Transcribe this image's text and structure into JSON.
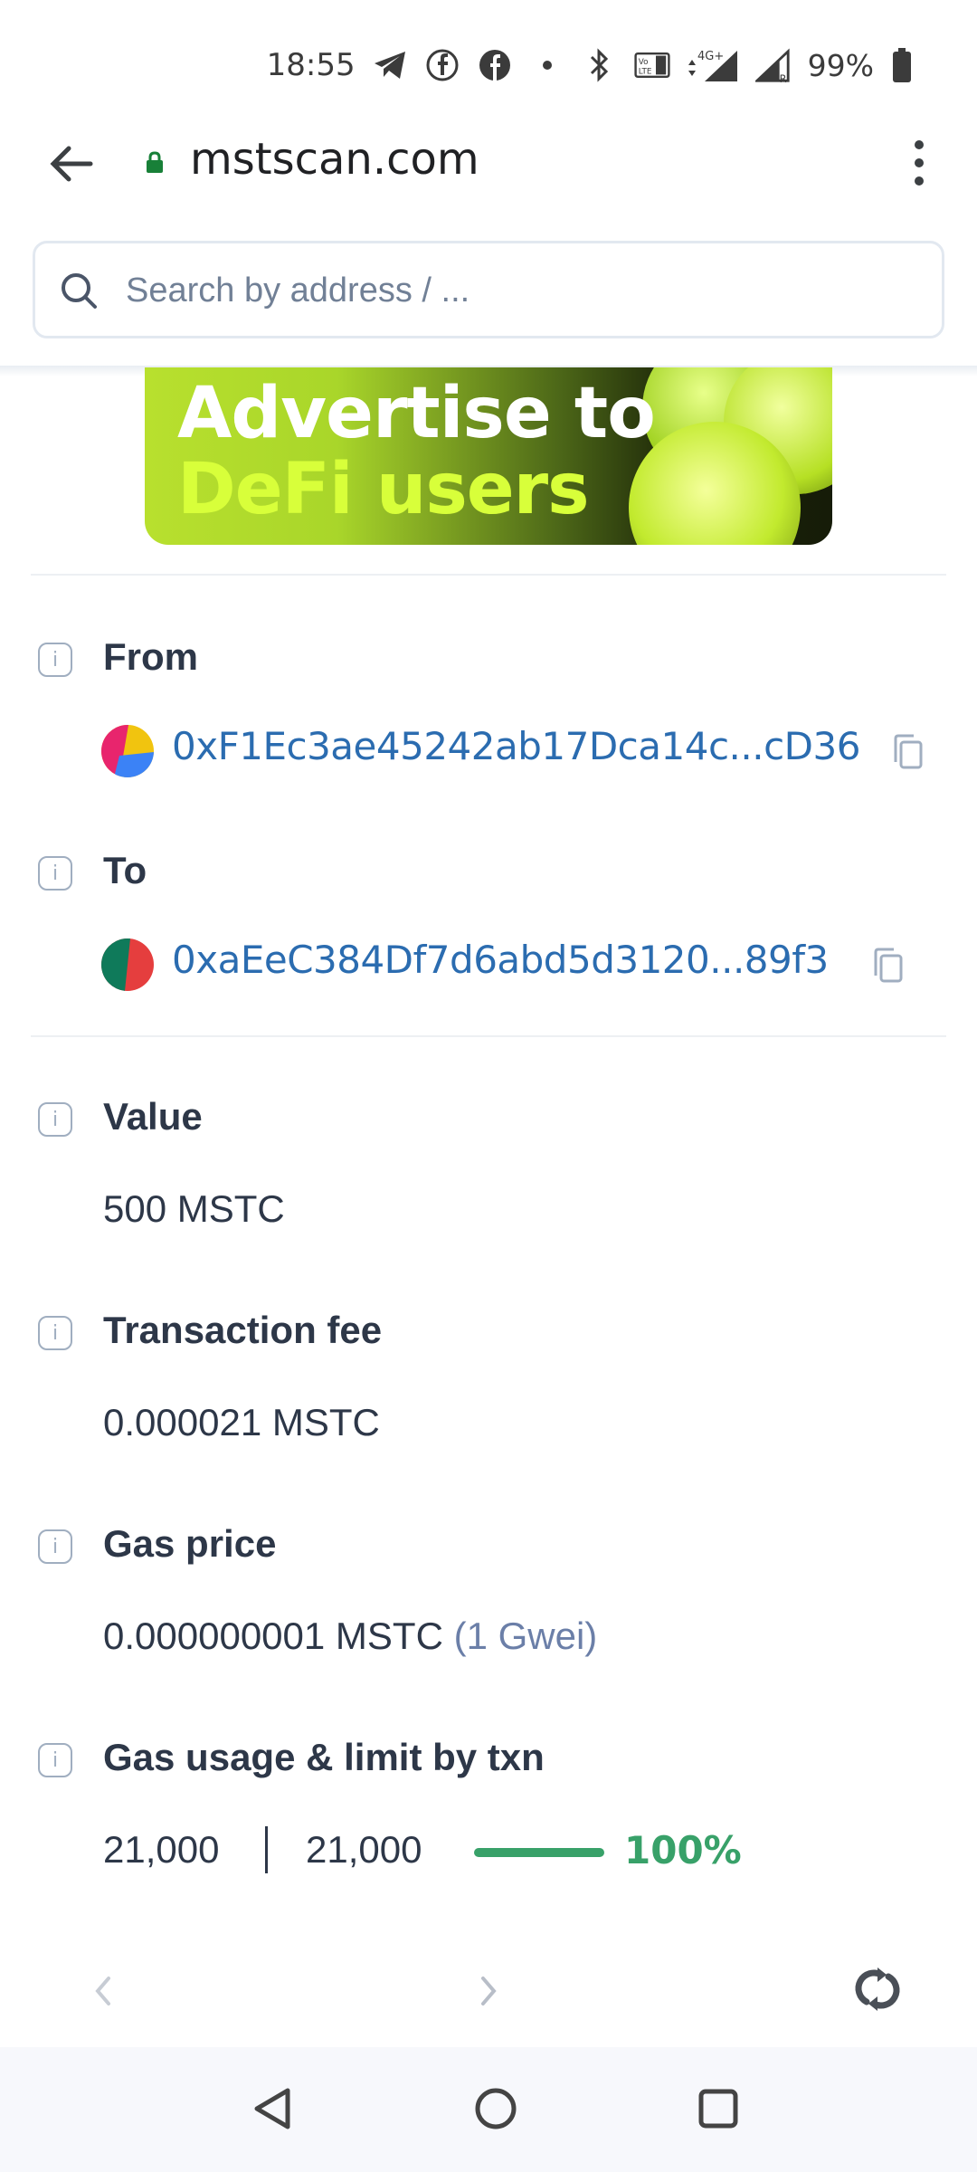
{
  "status_bar": {
    "time": "18:55",
    "network": "4G+",
    "battery": "99%"
  },
  "browser": {
    "url": "mstscan.com",
    "icons": [
      "back-arrow-icon",
      "lock-icon",
      "more-vert-icon"
    ]
  },
  "search": {
    "placeholder": "Search by address / ..."
  },
  "ad": {
    "line1": "Advertise to",
    "line2": "DeFi users",
    "colors": {
      "lime": "#d8ff3a",
      "dark": "#161c08"
    }
  },
  "transaction": {
    "from": {
      "label": "From",
      "address": "0xF1Ec3ae45242ab17Dca14c...cD36"
    },
    "to": {
      "label": "To",
      "address": "0xaEeC384Df7d6abd5d3120...89f3"
    },
    "value": {
      "label": "Value",
      "amount": "500 MSTC"
    },
    "fee": {
      "label": "Transaction fee",
      "amount": "0.000021 MSTC"
    },
    "gas_price": {
      "label": "Gas price",
      "amount": "0.000000001 MSTC",
      "gwei": "(1 Gwei)"
    },
    "gas_usage": {
      "label": "Gas usage & limit by txn",
      "used": "21,000",
      "limit": "21,000",
      "percent": "100%",
      "fill_fraction": 1.0
    }
  },
  "colors": {
    "link": "#2b6cb0",
    "success": "#38a169",
    "text": "#2d3748"
  }
}
